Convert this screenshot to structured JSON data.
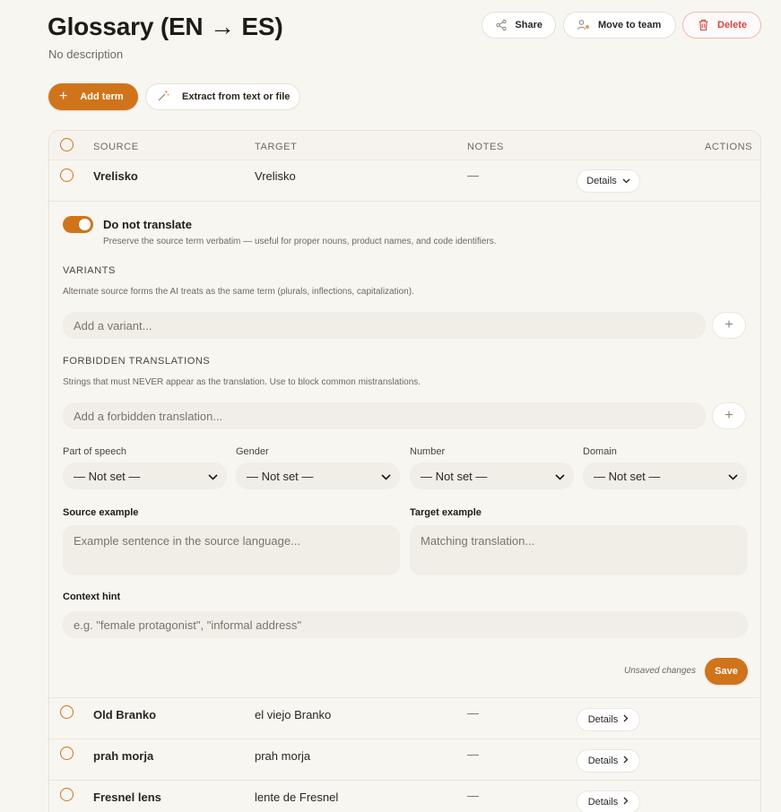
{
  "header": {
    "title": "Glossary (EN → ES)",
    "description": "No description",
    "share_label": "Share",
    "move_label": "Move to team",
    "delete_label": "Delete"
  },
  "toolbar": {
    "add_term_label": "Add term",
    "extract_label": "Extract from text or file"
  },
  "table": {
    "columns": [
      "SOURCE",
      "TARGET",
      "NOTES",
      "ACTIONS"
    ],
    "rows": [
      {
        "source": "Vrelisko",
        "target": "Vrelisko",
        "notes": "—",
        "details": "Details"
      },
      {
        "source": "Old Branko",
        "target": "el viejo Branko",
        "notes": "—",
        "details": "Details"
      },
      {
        "source": "prah morja",
        "target": "prah morja",
        "notes": "—",
        "details": "Details"
      },
      {
        "source": "Fresnel lens",
        "target": "lente de Fresnel",
        "notes": "—",
        "details": "Details"
      }
    ]
  },
  "details_panel": {
    "do_not_translate_enabled": true,
    "do_not_translate_label": "Do not translate",
    "do_not_translate_help": "Preserve the source term verbatim — useful for proper nouns, product names, and code identifiers.",
    "variants_title": "VARIANTS",
    "variants_help": "Alternate source forms the AI treats as the same term (plurals, inflections, capitalization).",
    "variants_placeholder": "Add a variant...",
    "forbidden_title": "FORBIDDEN TRANSLATIONS",
    "forbidden_help": "Strings that must NEVER appear as the translation. Use to block common mistranslations.",
    "forbidden_placeholder": "Add a forbidden translation...",
    "selects": [
      {
        "label": "Part of speech",
        "value": "— Not set —"
      },
      {
        "label": "Gender",
        "value": "— Not set —"
      },
      {
        "label": "Number",
        "value": "— Not set —"
      },
      {
        "label": "Domain",
        "value": "— Not set —"
      }
    ],
    "source_example_label": "Source example",
    "source_example_placeholder": "Example sentence in the source language...",
    "target_example_label": "Target example",
    "target_example_placeholder": "Matching translation...",
    "context_hint_label": "Context hint",
    "context_hint_placeholder": "e.g. \"female protagonist\", \"informal address\"",
    "unsaved_label": "Unsaved changes",
    "save_label": "Save"
  },
  "colors": {
    "accent": "#d0741b",
    "danger": "#d3453f",
    "background": "#f8f6f1"
  },
  "icons": [
    "share-icon",
    "move-to-team-icon",
    "trash-icon",
    "plus-icon",
    "magic-wand-icon",
    "chevron-down-icon",
    "chevron-right-icon"
  ]
}
